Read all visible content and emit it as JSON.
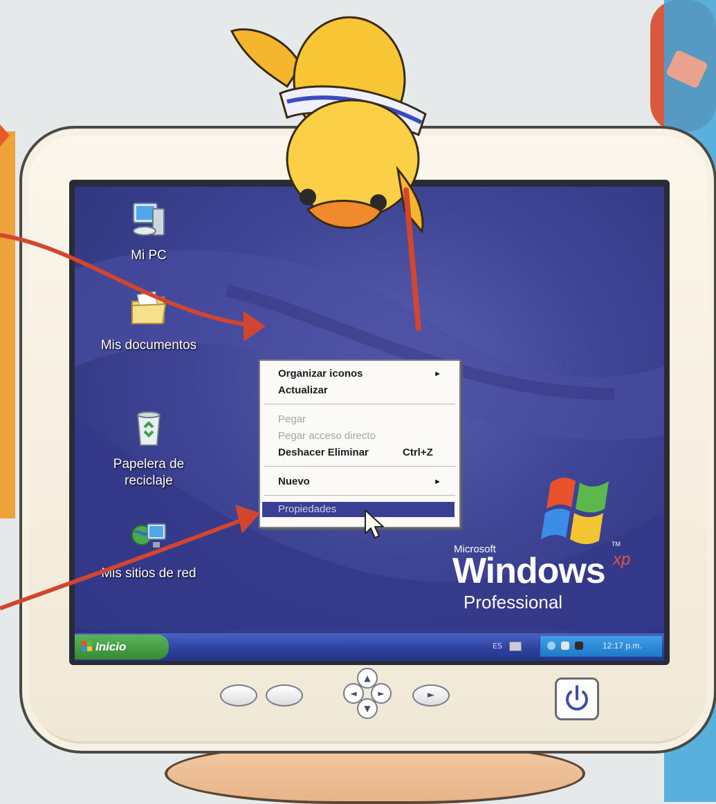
{
  "desktop": {
    "icons": [
      {
        "label": "Mi PC",
        "icon": "my-computer-icon"
      },
      {
        "label": "Mis documentos",
        "icon": "my-documents-icon"
      },
      {
        "label": "Papelera de reciclaje",
        "icon": "recycle-bin-icon"
      },
      {
        "label": "Mis sitios de red",
        "icon": "network-places-icon"
      }
    ]
  },
  "context_menu": {
    "items": [
      {
        "label": "Organizar iconos",
        "state": "enabled",
        "submenu": true
      },
      {
        "label": "Actualizar",
        "state": "enabled"
      },
      {
        "label": "Pegar",
        "state": "disabled"
      },
      {
        "label": "Pegar acceso directo",
        "state": "disabled"
      },
      {
        "label": "Deshacer Eliminar",
        "state": "enabled",
        "shortcut": "Ctrl+Z"
      },
      {
        "label": "Nuevo",
        "state": "enabled",
        "submenu": true
      },
      {
        "label": "Propiedades",
        "state": "highlighted"
      }
    ],
    "submenu_arrow": "►"
  },
  "branding": {
    "microsoft": "Microsoft",
    "windows": "Windows",
    "xp": "xp",
    "tm": "TM",
    "edition": "Professional"
  },
  "taskbar": {
    "start_label": "Inicio",
    "language": "ES",
    "clock": "12:17 p.m."
  },
  "colors": {
    "desktop": "#3f4595",
    "taskbar": "#2d3f9a",
    "start_button": "#338a33",
    "menu_highlight": "#3a3f94",
    "arrow": "#d2452e",
    "bezel": "#fbf7ec"
  }
}
